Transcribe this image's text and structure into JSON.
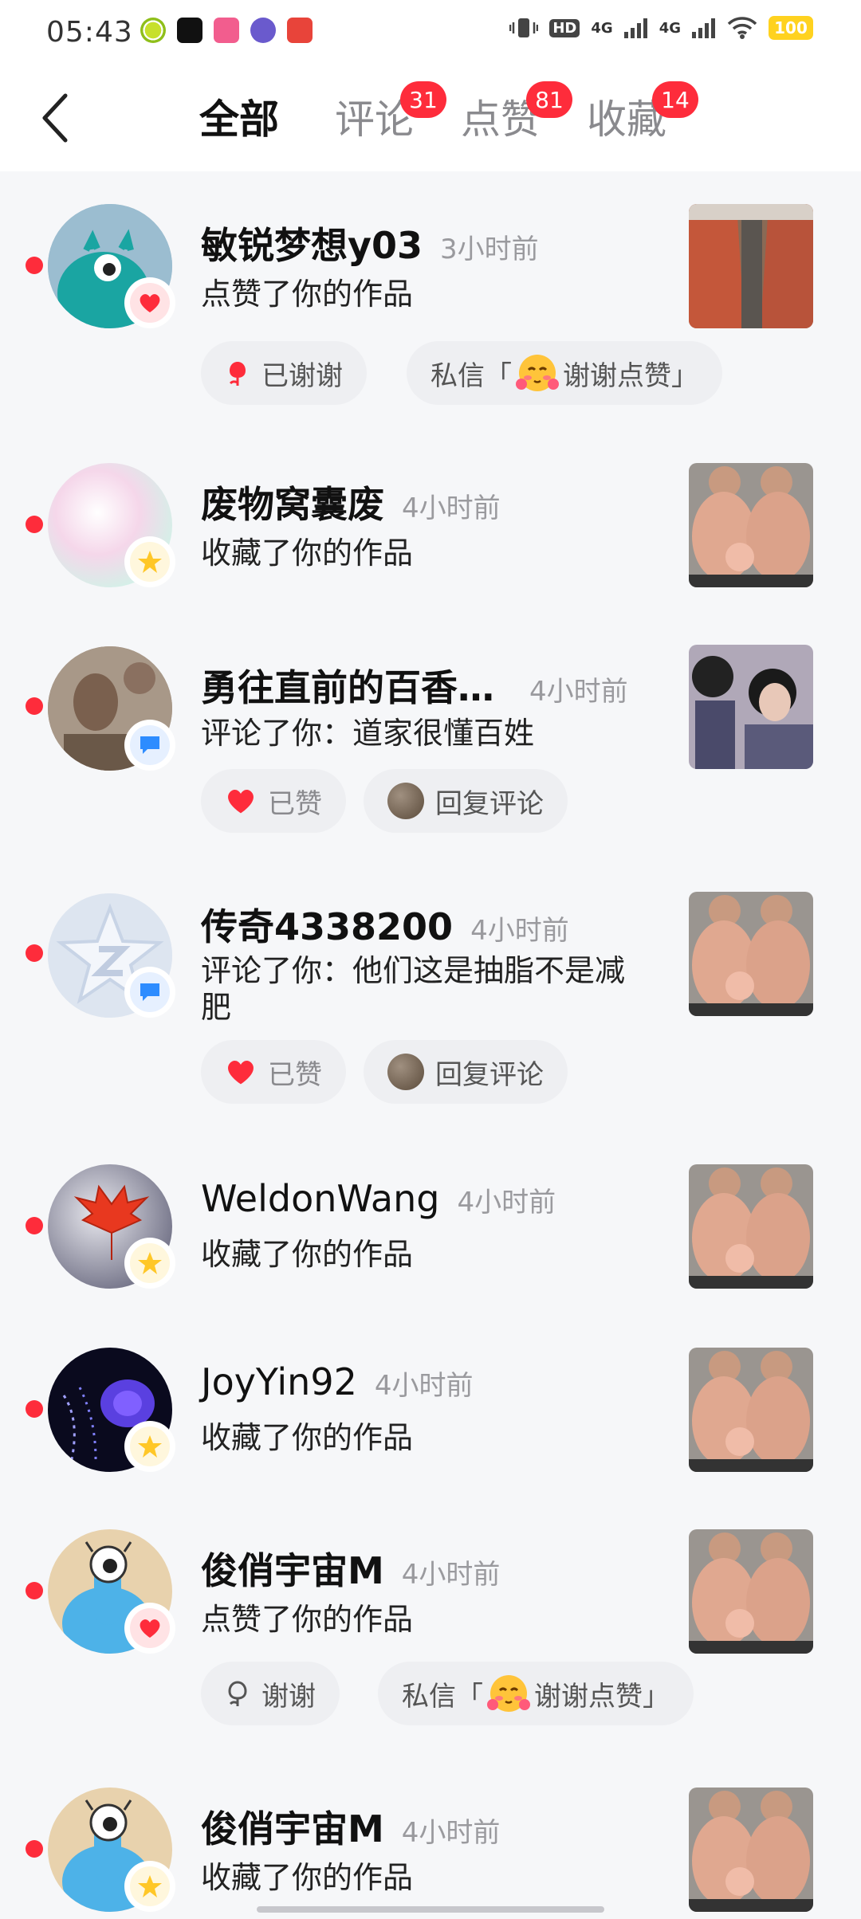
{
  "status": {
    "time": "05:43",
    "battery": "100",
    "network": [
      "HD",
      "4G",
      "4G"
    ]
  },
  "tabs": [
    {
      "label": "全部",
      "badge": ""
    },
    {
      "label": "评论",
      "badge": "31"
    },
    {
      "label": "点赞",
      "badge": "81"
    },
    {
      "label": "收藏",
      "badge": "14"
    }
  ],
  "items": [
    {
      "name": "敏锐梦想y03",
      "time": "3小时前",
      "desc": "点赞了你的作品",
      "badge_type": "heart-icon",
      "buttons": [
        {
          "label": "已谢谢",
          "icon": "flower-icon"
        },
        {
          "label": "私信「",
          "emoji": "blush-emoji",
          "label2": "谢谢点赞」"
        }
      ]
    },
    {
      "name": "废物窝囊废",
      "time": "4小时前",
      "desc": "收藏了你的作品",
      "badge_type": "star-icon",
      "buttons": []
    },
    {
      "name": "勇往直前的百香…",
      "time": "4小时前",
      "desc": "评论了你：道家很懂百姓",
      "badge_type": "comment-icon",
      "buttons": [
        {
          "label": "已赞",
          "icon": "heart-icon"
        },
        {
          "label": "回复评论",
          "icon": "reply-avatar"
        }
      ]
    },
    {
      "name": "传奇4338200",
      "time": "4小时前",
      "desc": "评论了你：他们这是抽脂不是减肥",
      "badge_type": "comment-icon",
      "buttons": [
        {
          "label": "已赞",
          "icon": "heart-icon"
        },
        {
          "label": "回复评论",
          "icon": "reply-avatar"
        }
      ]
    },
    {
      "name": "WeldonWang",
      "time": "4小时前",
      "desc": "收藏了你的作品",
      "badge_type": "star-icon",
      "buttons": []
    },
    {
      "name": "JoyYin92",
      "time": "4小时前",
      "desc": "收藏了你的作品",
      "badge_type": "star-icon",
      "buttons": []
    },
    {
      "name": "俊俏宇宙M",
      "time": "4小时前",
      "desc": "点赞了你的作品",
      "badge_type": "heart-icon",
      "buttons": [
        {
          "label": "谢谢",
          "icon": "flower-outline-icon"
        },
        {
          "label": "私信「",
          "emoji": "blush-emoji",
          "label2": "谢谢点赞」"
        }
      ]
    },
    {
      "name": "俊俏宇宙M",
      "time": "4小时前",
      "desc": "收藏了你的作品",
      "badge_type": "star-icon",
      "buttons": []
    }
  ],
  "colors": {
    "accent": "#fe2c3b",
    "star": "#ffc727",
    "comment": "#2d8cff",
    "background": "#f6f7f9"
  }
}
